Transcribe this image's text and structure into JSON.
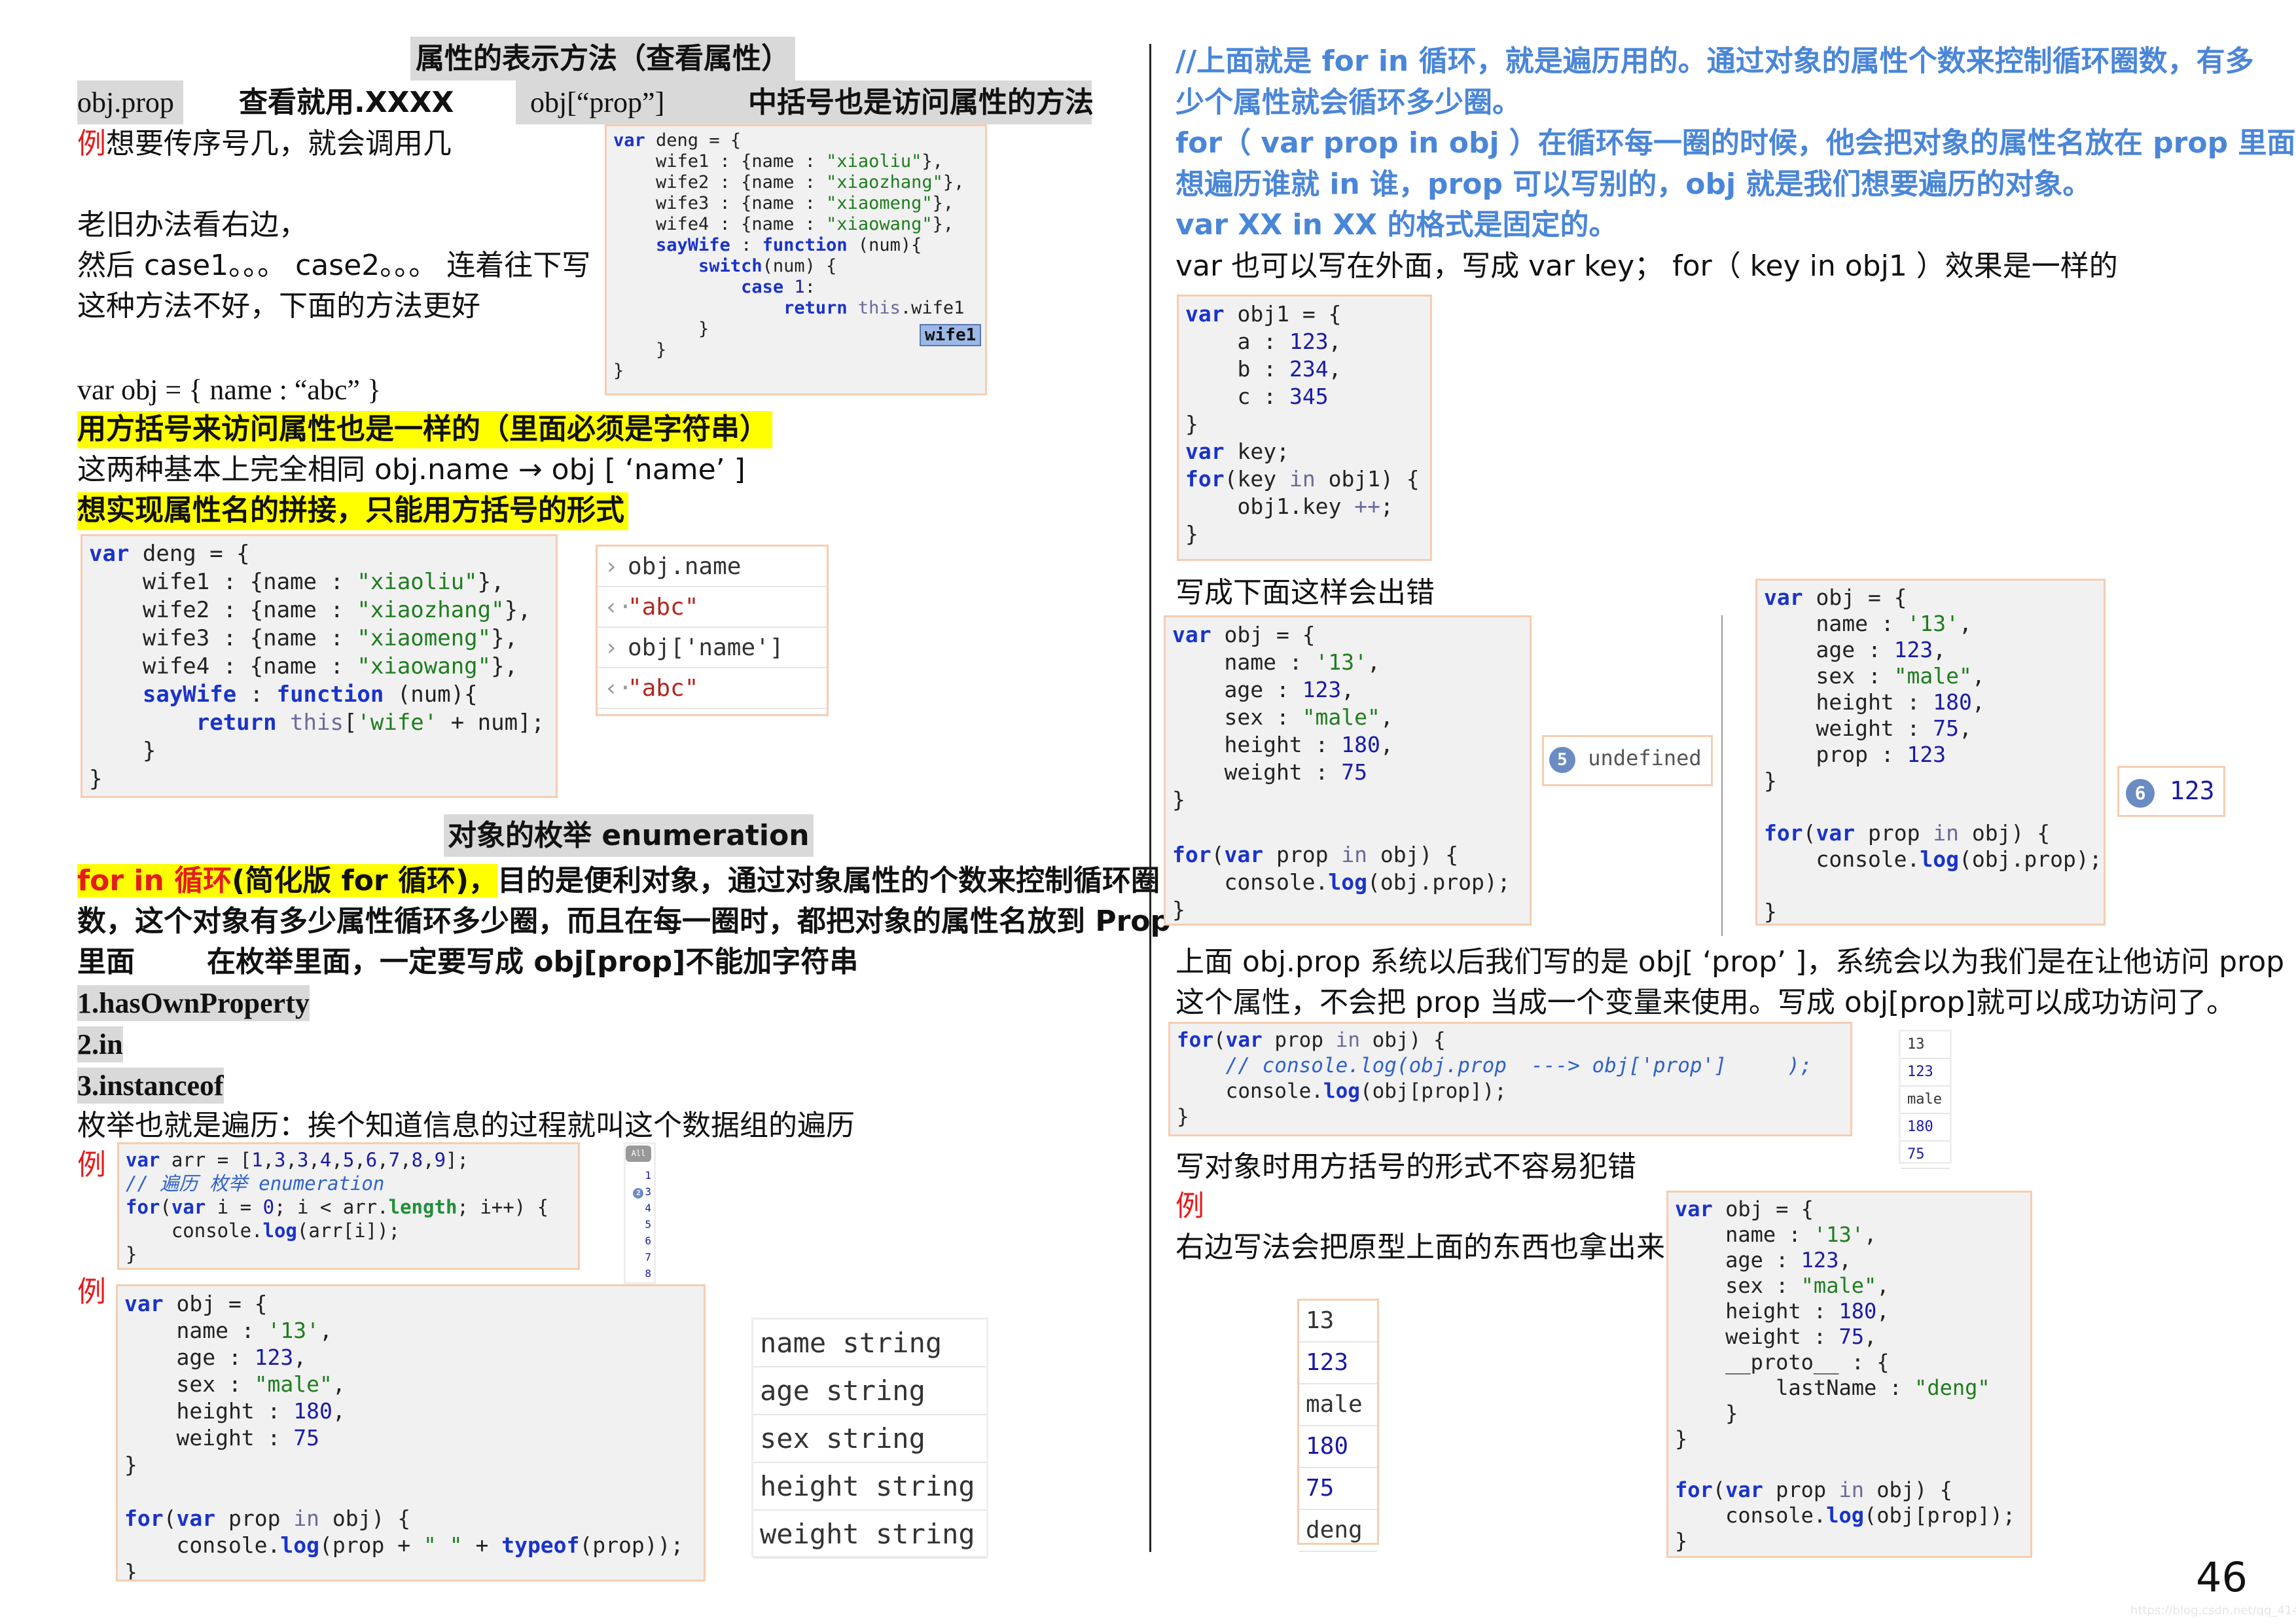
{
  "left": {
    "title": "属性的表示方法（查看属性）",
    "dot_syntax": "obj.prop",
    "dot_desc": "查看就用.XXXX",
    "bracket_syntax": "obj[“prop”]",
    "bracket_desc": "中括号也是访问属性的方法",
    "example_mark": "例",
    "example_text": "想要传序号几，就会调用几",
    "old_way_1": "老旧办法看右边，",
    "old_way_2": "然后 case1。。。  case2。。。 连着往下写",
    "old_way_3": "这种方法不好，下面的方法更好",
    "obj_literal": "var obj = { name :   “abc”   }",
    "highlight_1": "用方括号来访问属性也是一样的（里面必须是字符串）",
    "same_text": "这两种基本上完全相同 obj.name    →    obj [   ‘name’    ]",
    "highlight_2": "想实现属性名的拼接，只能用方括号的形式",
    "tooltip": "wife1",
    "code_switch": [
      [
        [
          "k",
          "var"
        ],
        [
          "p",
          " deng = {"
        ]
      ],
      [
        [
          "p",
          "    wife1 : {name : "
        ],
        [
          "s",
          "\"xiaoliu\""
        ],
        [
          "p",
          "},"
        ]
      ],
      [
        [
          "p",
          "    wife2 : {name : "
        ],
        [
          "s",
          "\"xiaozhang\""
        ],
        [
          "p",
          "},"
        ]
      ],
      [
        [
          "p",
          "    wife3 : {name : "
        ],
        [
          "s",
          "\"xiaomeng\""
        ],
        [
          "p",
          "},"
        ]
      ],
      [
        [
          "p",
          "    wife4 : {name : "
        ],
        [
          "s",
          "\"xiaowang\""
        ],
        [
          "p",
          "},"
        ]
      ],
      [
        [
          "k",
          "    sayWife"
        ],
        [
          "p",
          " : "
        ],
        [
          "k",
          "function"
        ],
        [
          "p",
          " (num){"
        ]
      ],
      [
        [
          "k",
          "        switch"
        ],
        [
          "p",
          "(num) {"
        ]
      ],
      [
        [
          "k",
          "            case"
        ],
        [
          "n",
          " 1"
        ],
        [
          "p",
          ":"
        ]
      ],
      [
        [
          "k",
          "                return"
        ],
        [
          "g",
          " this"
        ],
        [
          "p",
          ".wife1"
        ]
      ],
      [
        [
          "p",
          "        }"
        ]
      ],
      [
        [
          "p",
          "    }"
        ]
      ],
      [
        [
          "p",
          "}"
        ]
      ]
    ],
    "code_concat": [
      [
        [
          "k",
          "var"
        ],
        [
          "p",
          " deng = {"
        ]
      ],
      [
        [
          "p",
          "    wife1 : {name : "
        ],
        [
          "s",
          "\"xiaoliu\""
        ],
        [
          "p",
          "},"
        ]
      ],
      [
        [
          "p",
          "    wife2 : {name : "
        ],
        [
          "s",
          "\"xiaozhang\""
        ],
        [
          "p",
          "},"
        ]
      ],
      [
        [
          "p",
          "    wife3 : {name : "
        ],
        [
          "s",
          "\"xiaomeng\""
        ],
        [
          "p",
          "},"
        ]
      ],
      [
        [
          "p",
          "    wife4 : {name : "
        ],
        [
          "s",
          "\"xiaowang\""
        ],
        [
          "p",
          "},"
        ]
      ],
      [
        [
          "k",
          "    sayWife"
        ],
        [
          "p",
          " : "
        ],
        [
          "k",
          "function"
        ],
        [
          "p",
          " (num){"
        ]
      ],
      [
        [
          "k",
          "        return"
        ],
        [
          "g",
          " this"
        ],
        [
          "p",
          "["
        ],
        [
          "s",
          "'wife'"
        ],
        [
          "p",
          " + num];"
        ]
      ],
      [
        [
          "p",
          "    }"
        ]
      ],
      [
        [
          "p",
          "}"
        ]
      ]
    ],
    "console": [
      {
        "icon": "›",
        "text": "obj.name",
        "type": "input"
      },
      {
        "icon": "‹·",
        "text": "\"abc\"",
        "type": "output"
      },
      {
        "icon": "›",
        "text": "obj['name']",
        "type": "input"
      },
      {
        "icon": "‹·",
        "text": "\"abc\"",
        "type": "output"
      }
    ],
    "enum_title": "对象的枚举 enumeration",
    "forin_red": "for in 循环",
    "forin_black": "(简化版 for 循环)，",
    "forin_rest_1": "目的是便利对象，通过对象属性的个数来控制循环圈",
    "forin_line_2": "数，这个对象有多少属性循环多少圈，而且在每一圈时，都把对象的属性名放到 Prop",
    "forin_line_3a": "里面",
    "forin_line_3b": "在枚举里面，一定要写成 obj[prop]不能加字符串",
    "item_1": "1.hasOwnProperty",
    "item_2": "2.in",
    "item_3": "3.instanceof",
    "enum_desc": "枚举也就是遍历：挨个知道信息的过程就叫这个数据组的遍历",
    "example_mark_2": "例",
    "example_mark_3": "例",
    "code_arr": [
      [
        [
          "k",
          "var"
        ],
        [
          "p",
          " arr = ["
        ],
        [
          "n",
          "1"
        ],
        [
          "p",
          ","
        ],
        [
          "n",
          "3"
        ],
        [
          "p",
          ","
        ],
        [
          "n",
          "3"
        ],
        [
          "p",
          ","
        ],
        [
          "n",
          "4"
        ],
        [
          "p",
          ","
        ],
        [
          "n",
          "5"
        ],
        [
          "p",
          ","
        ],
        [
          "n",
          "6"
        ],
        [
          "p",
          ","
        ],
        [
          "n",
          "7"
        ],
        [
          "p",
          ","
        ],
        [
          "n",
          "8"
        ],
        [
          "p",
          ","
        ],
        [
          "n",
          "9"
        ],
        [
          "p",
          "];"
        ]
      ],
      [
        [
          "c",
          "// 遍历 枚举 enumeration"
        ]
      ],
      [
        [
          "k",
          "for"
        ],
        [
          "p",
          "("
        ],
        [
          "k",
          "var"
        ],
        [
          "p",
          " i = "
        ],
        [
          "n",
          "0"
        ],
        [
          "p",
          "; i < arr."
        ],
        [
          "m",
          "length"
        ],
        [
          "p",
          "; i++) {"
        ]
      ],
      [
        [
          "p",
          "    console."
        ],
        [
          "k",
          "log"
        ],
        [
          "p",
          "(arr[i]);"
        ]
      ],
      [
        [
          "p",
          "}"
        ]
      ]
    ],
    "arr_console_filter": "All",
    "arr_console": [
      {
        "count": "",
        "value": "1"
      },
      {
        "count": "2",
        "value": "3"
      },
      {
        "count": "",
        "value": "4"
      },
      {
        "count": "",
        "value": "5"
      },
      {
        "count": "",
        "value": "6"
      },
      {
        "count": "",
        "value": "7"
      },
      {
        "count": "",
        "value": "8"
      }
    ],
    "code_typeof": [
      [
        [
          "k",
          "var"
        ],
        [
          "p",
          " obj = {"
        ]
      ],
      [
        [
          "p",
          "    name : "
        ],
        [
          "s",
          "'13'"
        ],
        [
          "p",
          ","
        ]
      ],
      [
        [
          "p",
          "    age : "
        ],
        [
          "n",
          "123"
        ],
        [
          "p",
          ","
        ]
      ],
      [
        [
          "p",
          "    sex : "
        ],
        [
          "s",
          "\"male\""
        ],
        [
          "p",
          ","
        ]
      ],
      [
        [
          "p",
          "    height : "
        ],
        [
          "n",
          "180"
        ],
        [
          "p",
          ","
        ]
      ],
      [
        [
          "p",
          "    weight : "
        ],
        [
          "n",
          "75"
        ]
      ],
      [
        [
          "p",
          "}"
        ]
      ],
      [
        [
          "p",
          ""
        ]
      ],
      [
        [
          "k",
          "for"
        ],
        [
          "p",
          "("
        ],
        [
          "k",
          "var"
        ],
        [
          "p",
          " prop "
        ],
        [
          "g",
          "in"
        ],
        [
          "p",
          " obj) {"
        ]
      ],
      [
        [
          "p",
          "    console."
        ],
        [
          "k",
          "log"
        ],
        [
          "p",
          "(prop + "
        ],
        [
          "s",
          "\" \""
        ],
        [
          "p",
          " + "
        ],
        [
          "k",
          "typeof"
        ],
        [
          "p",
          "(prop));"
        ]
      ],
      [
        [
          "p",
          "}"
        ]
      ]
    ],
    "typeof_output": [
      "name string",
      "age string",
      "sex string",
      "height string",
      "weight string"
    ]
  },
  "right": {
    "note_1": "//上面就是 for in 循环，就是遍历用的。通过对象的属性个数来控制循环圈数，有多",
    "note_2": "少个属性就会循环多少圈。",
    "note_3": "for（ var prop in obj ）在循环每一圈的时候，他会把对象的属性名放在 prop 里面。",
    "note_4": "想遍历谁就 in 谁，prop 可以写别的，obj 就是我们想要遍历的对象。",
    "note_5": "var XX in XX 的格式是固定的。",
    "note_6": "var 也可以写在外面，写成 var key；   for（ key in obj1 ）效果是一样的",
    "code_key": [
      [
        [
          "k",
          "var"
        ],
        [
          "p",
          " obj1 = {"
        ]
      ],
      [
        [
          "p",
          "    a : "
        ],
        [
          "n",
          "123"
        ],
        [
          "p",
          ","
        ]
      ],
      [
        [
          "p",
          "    b : "
        ],
        [
          "n",
          "234"
        ],
        [
          "p",
          ","
        ]
      ],
      [
        [
          "p",
          "    c : "
        ],
        [
          "n",
          "345"
        ]
      ],
      [
        [
          "p",
          "}"
        ]
      ],
      [
        [
          "k",
          "var"
        ],
        [
          "p",
          " key;"
        ]
      ],
      [
        [
          "k",
          "for"
        ],
        [
          "p",
          "(key "
        ],
        [
          "g",
          "in"
        ],
        [
          "p",
          " obj1) {"
        ]
      ],
      [
        [
          "p",
          "    obj1.key "
        ],
        [
          "g",
          "++"
        ],
        [
          "p",
          ";"
        ]
      ],
      [
        [
          "p",
          "}"
        ]
      ]
    ],
    "error_title": "写成下面这样会出错",
    "code_error": [
      [
        [
          "k",
          "var"
        ],
        [
          "p",
          " obj = {"
        ]
      ],
      [
        [
          "p",
          "    name : "
        ],
        [
          "s",
          "'13'"
        ],
        [
          "p",
          ","
        ]
      ],
      [
        [
          "p",
          "    age : "
        ],
        [
          "n",
          "123"
        ],
        [
          "p",
          ","
        ]
      ],
      [
        [
          "p",
          "    sex : "
        ],
        [
          "s",
          "\"male\""
        ],
        [
          "p",
          ","
        ]
      ],
      [
        [
          "p",
          "    height : "
        ],
        [
          "n",
          "180"
        ],
        [
          "p",
          ","
        ]
      ],
      [
        [
          "p",
          "    weight : "
        ],
        [
          "n",
          "75"
        ]
      ],
      [
        [
          "p",
          "}"
        ]
      ],
      [
        [
          "p",
          ""
        ]
      ],
      [
        [
          "k",
          "for"
        ],
        [
          "p",
          "("
        ],
        [
          "k",
          "var"
        ],
        [
          "p",
          " prop "
        ],
        [
          "g",
          "in"
        ],
        [
          "p",
          " obj) {"
        ]
      ],
      [
        [
          "p",
          "    console."
        ],
        [
          "k",
          "log"
        ],
        [
          "p",
          "(obj.prop);"
        ]
      ],
      [
        [
          "p",
          "}"
        ]
      ]
    ],
    "error_output": {
      "count": "5",
      "value": "undefined"
    },
    "code_prop": [
      [
        [
          "k",
          "var"
        ],
        [
          "p",
          " obj = {"
        ]
      ],
      [
        [
          "p",
          "    name : "
        ],
        [
          "s",
          "'13'"
        ],
        [
          "p",
          ","
        ]
      ],
      [
        [
          "p",
          "    age : "
        ],
        [
          "n",
          "123"
        ],
        [
          "p",
          ","
        ]
      ],
      [
        [
          "p",
          "    sex : "
        ],
        [
          "s",
          "\"male\""
        ],
        [
          "p",
          ","
        ]
      ],
      [
        [
          "p",
          "    height : "
        ],
        [
          "n",
          "180"
        ],
        [
          "p",
          ","
        ]
      ],
      [
        [
          "p",
          "    weight : "
        ],
        [
          "n",
          "75"
        ],
        [
          "p",
          ","
        ]
      ],
      [
        [
          "p",
          "    prop : "
        ],
        [
          "n",
          "123"
        ]
      ],
      [
        [
          "p",
          "}"
        ]
      ],
      [
        [
          "p",
          ""
        ]
      ],
      [
        [
          "k",
          "for"
        ],
        [
          "p",
          "("
        ],
        [
          "k",
          "var"
        ],
        [
          "p",
          " prop "
        ],
        [
          "g",
          "in"
        ],
        [
          "p",
          " obj) {"
        ]
      ],
      [
        [
          "p",
          "    console."
        ],
        [
          "k",
          "log"
        ],
        [
          "p",
          "(obj.prop);"
        ]
      ],
      [
        [
          "p",
          ""
        ]
      ],
      [
        [
          "p",
          "}"
        ]
      ]
    ],
    "prop_output": {
      "count": "6",
      "value": "123"
    },
    "explain_1": "上面 obj.prop 系统以后我们写的是 obj[ ‘prop’ ]，系统会以为我们是在让他访问 prop",
    "explain_2": "这个属性，不会把 prop 当成一个变量来使用。写成 obj[prop]就可以成功访问了。",
    "code_bracket": [
      [
        [
          "k",
          "for"
        ],
        [
          "p",
          "("
        ],
        [
          "k",
          "var"
        ],
        [
          "p",
          " prop "
        ],
        [
          "g",
          "in"
        ],
        [
          "p",
          " obj) {"
        ]
      ],
      [
        [
          "c",
          "    // console.log(obj.prop  ---> obj['prop']     );"
        ]
      ],
      [
        [
          "p",
          "    console."
        ],
        [
          "k",
          "log"
        ],
        [
          "p",
          "(obj[prop]);"
        ]
      ],
      [
        [
          "p",
          "}"
        ]
      ]
    ],
    "bracket_output": [
      "13",
      "123",
      "male",
      "180",
      "75"
    ],
    "tip": "写对象时用方括号的形式不容易犯错",
    "example_mark": "例",
    "proto_note": "右边写法会把原型上面的东西也拿出来",
    "proto_output": [
      "13",
      "123",
      "male",
      "180",
      "75",
      "deng"
    ],
    "code_proto": [
      [
        [
          "k",
          "var"
        ],
        [
          "p",
          " obj = {"
        ]
      ],
      [
        [
          "p",
          "    name : "
        ],
        [
          "s",
          "'13'"
        ],
        [
          "p",
          ","
        ]
      ],
      [
        [
          "p",
          "    age : "
        ],
        [
          "n",
          "123"
        ],
        [
          "p",
          ","
        ]
      ],
      [
        [
          "p",
          "    sex : "
        ],
        [
          "s",
          "\"male\""
        ],
        [
          "p",
          ","
        ]
      ],
      [
        [
          "p",
          "    height : "
        ],
        [
          "n",
          "180"
        ],
        [
          "p",
          ","
        ]
      ],
      [
        [
          "p",
          "    weight : "
        ],
        [
          "n",
          "75"
        ],
        [
          "p",
          ","
        ]
      ],
      [
        [
          "p",
          "    __proto__ : {"
        ]
      ],
      [
        [
          "p",
          "        lastName : "
        ],
        [
          "s",
          "\"deng\""
        ]
      ],
      [
        [
          "p",
          "    }"
        ]
      ],
      [
        [
          "p",
          "}"
        ]
      ],
      [
        [
          "p",
          ""
        ]
      ],
      [
        [
          "k",
          "for"
        ],
        [
          "p",
          "("
        ],
        [
          "k",
          "var"
        ],
        [
          "p",
          " prop "
        ],
        [
          "g",
          "in"
        ],
        [
          "p",
          " obj) {"
        ]
      ],
      [
        [
          "p",
          "    console."
        ],
        [
          "k",
          "log"
        ],
        [
          "p",
          "(obj[prop]);"
        ]
      ],
      [
        [
          "p",
          "}"
        ]
      ]
    ]
  },
  "page_number": "46",
  "watermark": "https://blog.csdn.net/qq_41442781",
  "colors": {
    "note_blue": "#4a86d8",
    "highlight": "#ffff00",
    "heading_gray": "#d9d9d9",
    "red_mark": "#e41c1c",
    "code_border": "#f6cdb0",
    "keyword": "#1a33c9",
    "string": "#1e7d1e",
    "number": "#1a1aa6"
  }
}
